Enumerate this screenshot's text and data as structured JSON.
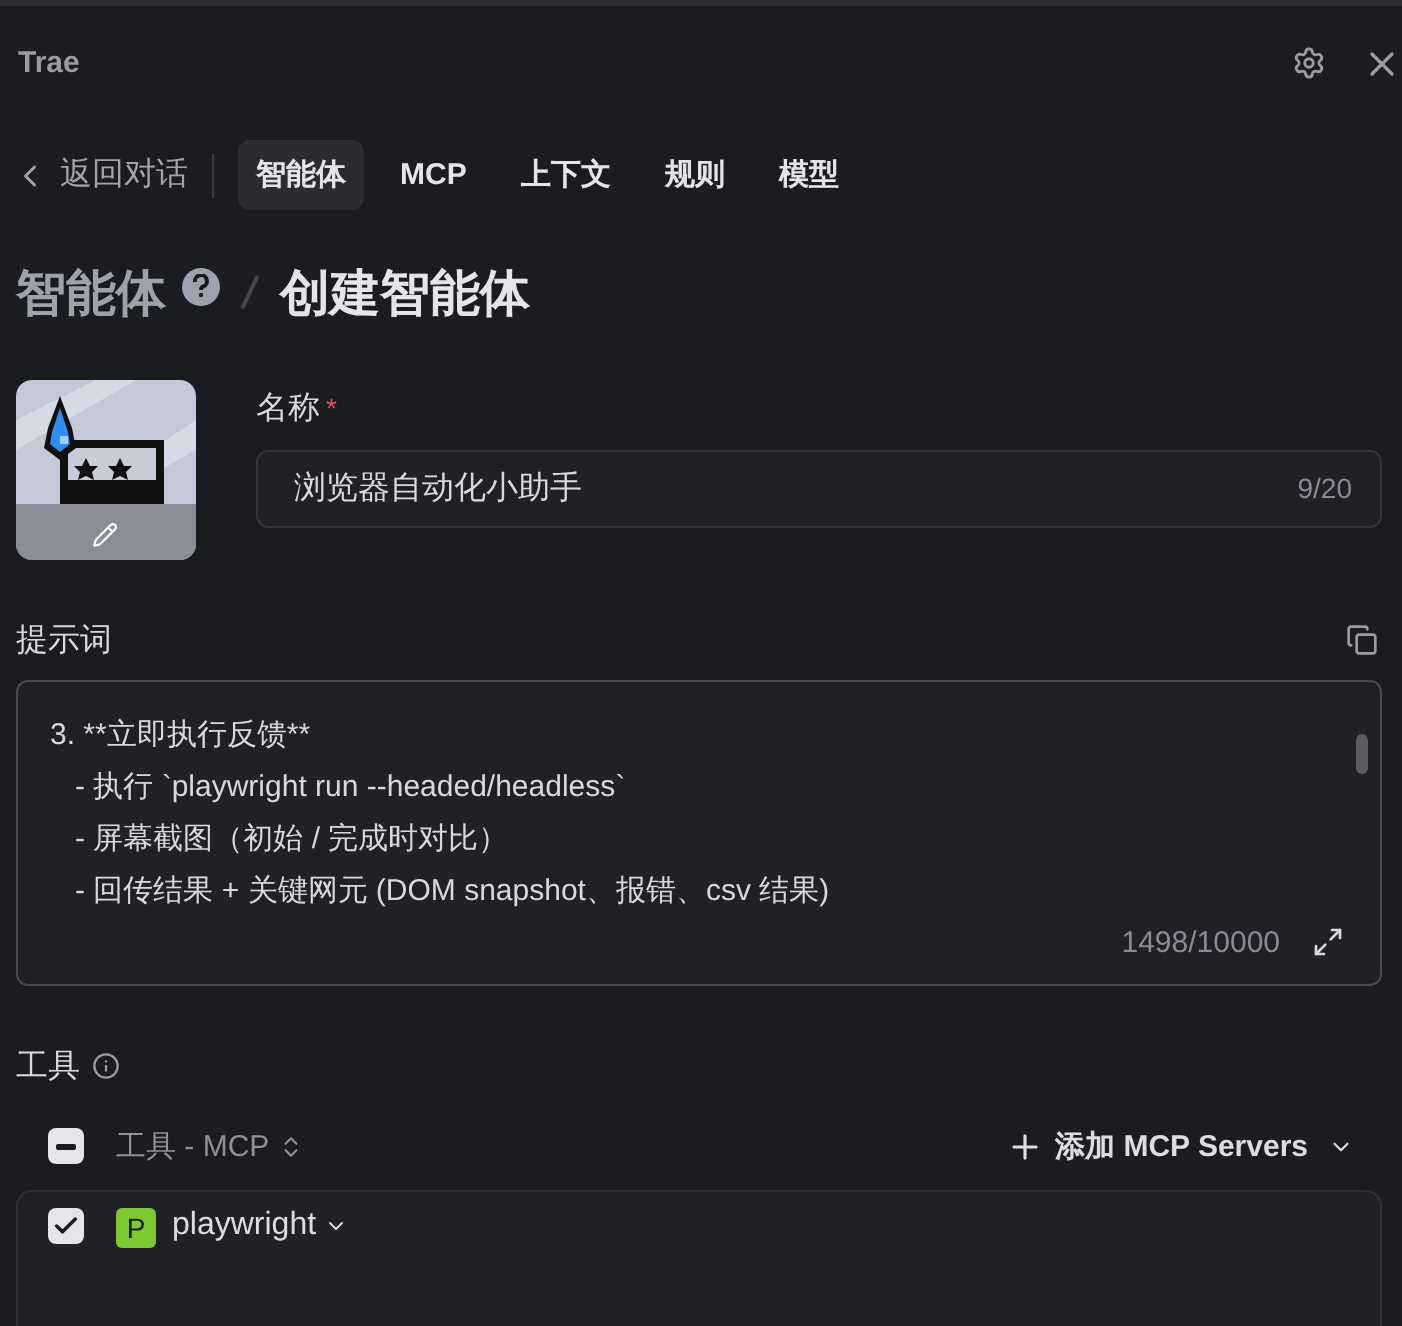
{
  "window": {
    "title": "Trae"
  },
  "nav": {
    "back": "返回对话",
    "tabs": [
      {
        "label": "智能体",
        "selected": true
      },
      {
        "label": "MCP",
        "selected": false
      },
      {
        "label": "上下文",
        "selected": false
      },
      {
        "label": "规则",
        "selected": false
      },
      {
        "label": "模型",
        "selected": false
      }
    ]
  },
  "breadcrumb": {
    "parent": "智能体",
    "current": "创建智能体"
  },
  "name_field": {
    "label": "名称",
    "required_mark": "*",
    "value": "浏览器自动化小助手",
    "counter": "9/20"
  },
  "prompt": {
    "label": "提示词",
    "lines": [
      "3. **立即执行反馈**",
      "   - 执行 `playwright run --headed/headless`",
      "   - 屏幕截图（初始 / 完成时对比）",
      "   - 回传结果 + 关键网元 (DOM snapshot、报错、csv 结果)"
    ],
    "counter": "1498/10000"
  },
  "tools": {
    "label": "工具",
    "header": {
      "label": "工具 - MCP",
      "indeterminate": true
    },
    "add_button": "添加 MCP Servers",
    "servers": [
      {
        "letter": "P",
        "name": "playwright",
        "checked": true,
        "color": "#7cc832"
      }
    ]
  }
}
